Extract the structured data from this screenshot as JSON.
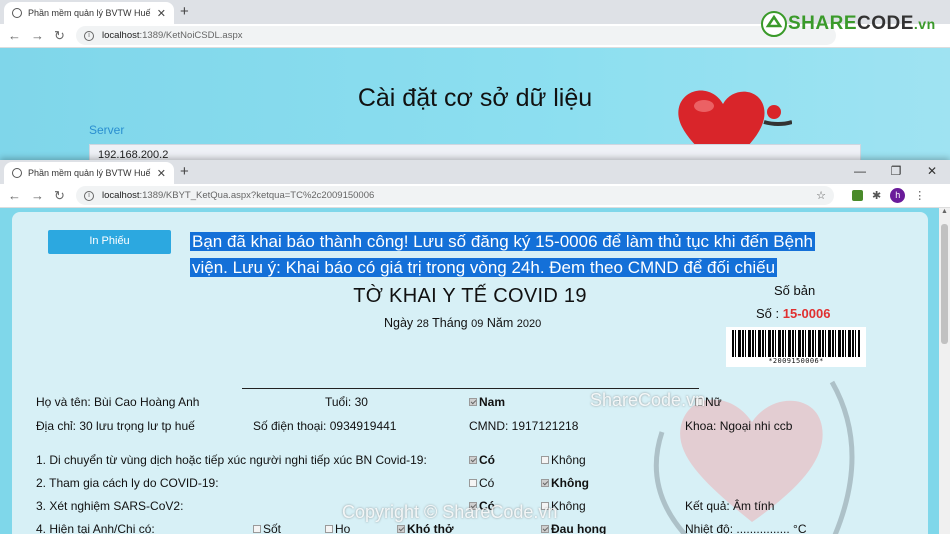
{
  "back_window": {
    "tab_title": "Phần mềm quản lý BVTW Huế",
    "url_host": "localhost",
    "url_path": ":1389/KetNoiCSDL.aspx",
    "page_title": "Cài đặt cơ sở dữ liệu",
    "server_label": "Server",
    "server_value": "192.168.200.2",
    "logo": {
      "part1": "SHARE",
      "part2": "CODE",
      "part3": ".vn"
    }
  },
  "front_window": {
    "tab_title": "Phần mềm quản lý BVTW Huế",
    "url_host": "localhost",
    "url_path": ":1389/KBYT_KetQua.aspx?ketqua=TC%2c2009150006",
    "avatar_letter": "h"
  },
  "icons": {
    "close": "✕",
    "new_tab": "+",
    "back": "←",
    "forward": "→",
    "reload": "↻",
    "minimize": "—",
    "restore": "❐",
    "star": "☆"
  },
  "form": {
    "print_button": "In Phiếu",
    "alert_line1": "Bạn đã khai báo thành công! Lưu số đăng ký 15-0006 để làm thủ tục khi đến Bệnh",
    "alert_line2": "viện. Lưu ý: Khai báo có giá trị trong vòng 24h. Đem theo CMND để đối chiếu",
    "title": "TỜ KHAI Y TẾ COVID 19",
    "date_ngay": "Ngày",
    "date_day": "28",
    "date_thang": "Tháng",
    "date_month": "09",
    "date_nam": "Năm",
    "date_year": "2020",
    "so_ban_label": "Số bản",
    "so_label": "Số :",
    "so_value": "15-0006",
    "barcode_text": "*2009150006*",
    "name": "Họ và tên: Bùi Cao Hoàng Anh",
    "age": "Tuổi: 30",
    "gender_male": "Nam",
    "gender_female": "Nữ",
    "address": "Địa chỉ: 30 lưu trọng lư tp huế",
    "phone": "Số điện thoại: 0934919441",
    "cmnd": "CMND: 1917121218",
    "department": "Khoa: Ngoại nhi ccb",
    "q1": "1. Di chuyển từ vùng dịch hoặc tiếp xúc người nghi tiếp xúc BN Covid-19:",
    "q2": "2. Tham gia cách ly do COVID-19:",
    "q3": "3. Xét nghiệm SARS-CoV2:",
    "q4": "4. Hiện tại Anh/Chị có:",
    "yes": "Có",
    "no": "Không",
    "result": "Kết quả: Âm tính",
    "sym_fever": "Sốt",
    "sym_cough": "Ho",
    "sym_breath": "Khó thở",
    "sym_throat": "Đau họng",
    "temperature": "Nhiệt độ: ................ °C"
  },
  "watermarks": {
    "center": "ShareCode.vn",
    "bottom": "Copyright © ShareCode.vn"
  }
}
